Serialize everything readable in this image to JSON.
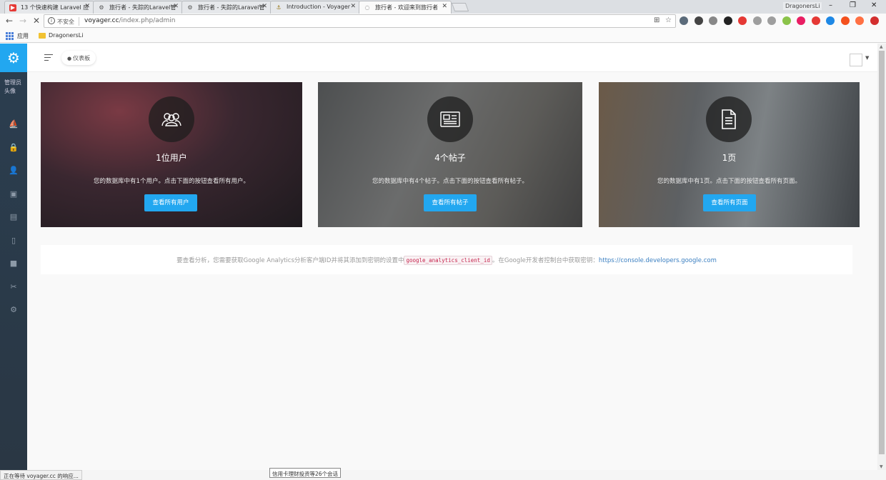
{
  "browser": {
    "tabs": [
      {
        "title": "13 个快速构建 Laravel 应",
        "icon": "youtube-icon",
        "active": false
      },
      {
        "title": "旅行者 - 失踪的Laravel管",
        "icon": "gear-icon",
        "active": false
      },
      {
        "title": "旅行者 - 失踪的Laravel管",
        "icon": "gear-icon",
        "active": false
      },
      {
        "title": "Introduction - Voyager",
        "icon": "ship-icon",
        "active": false
      },
      {
        "title": "旅行者 - 欢迎来到旅行者",
        "icon": "loading-icon",
        "active": true
      }
    ],
    "profile_name": "DragonersLi",
    "window_buttons": {
      "minimize": "–",
      "restore": "❐",
      "close": "✕"
    },
    "nav": {
      "back": "←",
      "forward": "→",
      "stop": "✕"
    },
    "security_label": "不安全",
    "url_host": "voyager.cc",
    "url_path": "/index.php/admin",
    "bookmarks": {
      "apps_label": "应用",
      "folder_label": "DragonersLi"
    },
    "extension_colors": [
      "#5b6b7a",
      "#444",
      "#888",
      "#222",
      "#e53935",
      "#9e9e9e",
      "#9e9e9e",
      "#8bc34a",
      "#e91e63",
      "#e53935",
      "#1e88e5",
      "#f4511e",
      "#ff7043",
      "#d32f2f"
    ]
  },
  "sidebar": {
    "brand_icon": "gear-icon",
    "avatar_alt": "管理员头像",
    "items": [
      {
        "name": "dashboard",
        "icon": "boat-icon",
        "active": true,
        "glyph": "⛵"
      },
      {
        "name": "roles",
        "icon": "lock-icon",
        "active": false,
        "glyph": "🔒"
      },
      {
        "name": "users",
        "icon": "user-icon",
        "active": false,
        "glyph": "👤"
      },
      {
        "name": "media",
        "icon": "image-icon",
        "active": false,
        "glyph": "▣"
      },
      {
        "name": "posts",
        "icon": "news-icon",
        "active": false,
        "glyph": "▤"
      },
      {
        "name": "pages",
        "icon": "document-icon",
        "active": false,
        "glyph": "▯"
      },
      {
        "name": "categories",
        "icon": "folder-icon",
        "active": false,
        "glyph": "■"
      },
      {
        "name": "tools",
        "icon": "tools-icon",
        "active": false,
        "glyph": "✂"
      },
      {
        "name": "settings",
        "icon": "settings-icon",
        "active": false,
        "glyph": "⚙"
      }
    ]
  },
  "header": {
    "breadcrumb": "仪表板"
  },
  "cards": [
    {
      "icon": "users-icon",
      "title": "1位用户",
      "description": "您的数据库中有1个用户。点击下面的按钮查看所有用户。",
      "button": "查看所有用户",
      "bg": "#3a2f33"
    },
    {
      "icon": "newspaper-icon",
      "title": "4个帖子",
      "description": "您的数据库中有4个帖子。点击下面的按钮查看所有帖子。",
      "button": "查看所有帖子",
      "bg": "#5b5d5e"
    },
    {
      "icon": "file-text-icon",
      "title": "1页",
      "description": "您的数据库中有1页。点击下面的按钮查看所有页面。",
      "button": "查看所有页面",
      "bg": "#5f6467"
    }
  ],
  "analytics": {
    "text_before": "要查看分析，您需要获取Google Analytics分析客户端ID并将其添加到密钥的设置中",
    "code": "google_analytics_client_id",
    "text_after": "。在Google开发者控制台中获取密钥：",
    "link": "https://console.developers.google.com"
  },
  "status": {
    "loading": "正在等待 voyager.cc 的响应...",
    "tooltip": "信用卡理财投资等26个会话"
  }
}
